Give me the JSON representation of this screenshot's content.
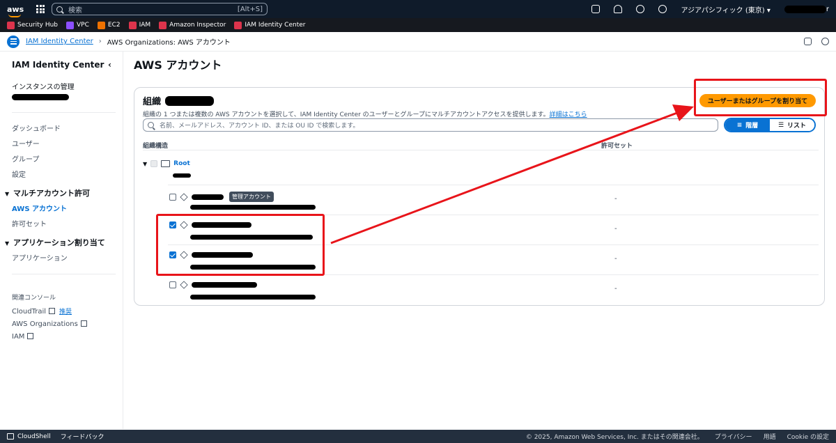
{
  "topnav": {
    "logo_text": "aws",
    "search_placeholder": "検索",
    "search_shortcut": "[Alt+S]",
    "region": "アジアパシフィック (東京) ▾",
    "user_suffix": "r"
  },
  "favorites": [
    {
      "label": "Security Hub",
      "color": "#dd344c"
    },
    {
      "label": "VPC",
      "color": "#8c4fff"
    },
    {
      "label": "EC2",
      "color": "#ed7100"
    },
    {
      "label": "IAM",
      "color": "#dd344c"
    },
    {
      "label": "Amazon Inspector",
      "color": "#dd344c"
    },
    {
      "label": "IAM Identity Center",
      "color": "#dd344c"
    }
  ],
  "breadcrumb": {
    "root": "IAM Identity Center",
    "current": "AWS Organizations: AWS アカウント"
  },
  "sidebar": {
    "title": "IAM Identity Center",
    "collapse_icon": "‹",
    "instance_label": "インスタンスの管理",
    "items_top": [
      "ダッシュボード",
      "ユーザー",
      "グループ",
      "設定"
    ],
    "section_multi": "マルチアカウント許可",
    "multi_items": [
      "AWS アカウント",
      "許可セット"
    ],
    "section_app": "アプリケーション割り当て",
    "app_items": [
      "アプリケーション"
    ],
    "related_label": "関連コンソール",
    "cloudtrail": "CloudTrail",
    "new_badge": "推奨",
    "orgs": "AWS Organizations",
    "iam": "IAM"
  },
  "main": {
    "page_title": "AWS アカウント",
    "panel_title": "組織",
    "panel_desc": "組織の 1 つまたは複数の AWS アカウントを選択して、IAM Identity Center のユーザーとグループにマルチアカウントアクセスを提供します。",
    "panel_desc_link": "詳細はこちら",
    "search_placeholder": "名前、メールアドレス、アカウント ID、または OU ID で検索します。",
    "view_hierarchy": "階層",
    "view_list": "リスト",
    "assign_button": "ユーザーまたはグループを割り当て",
    "col_structure": "組織構造",
    "col_permission": "許可セット",
    "root_label": "Root",
    "mgmt_tooltip": "管理アカウント",
    "accounts": [
      {
        "checked": false,
        "perm": "-"
      },
      {
        "checked": true,
        "perm": "-"
      },
      {
        "checked": true,
        "perm": "-"
      },
      {
        "checked": false,
        "perm": "-"
      }
    ]
  },
  "footer": {
    "cloudshell": "CloudShell",
    "feedback": "フィードバック",
    "copyright": "© 2025, Amazon Web Services, Inc. またはその関連会社。",
    "privacy": "プライバシー",
    "terms": "用語",
    "cookie": "Cookie の設定"
  }
}
